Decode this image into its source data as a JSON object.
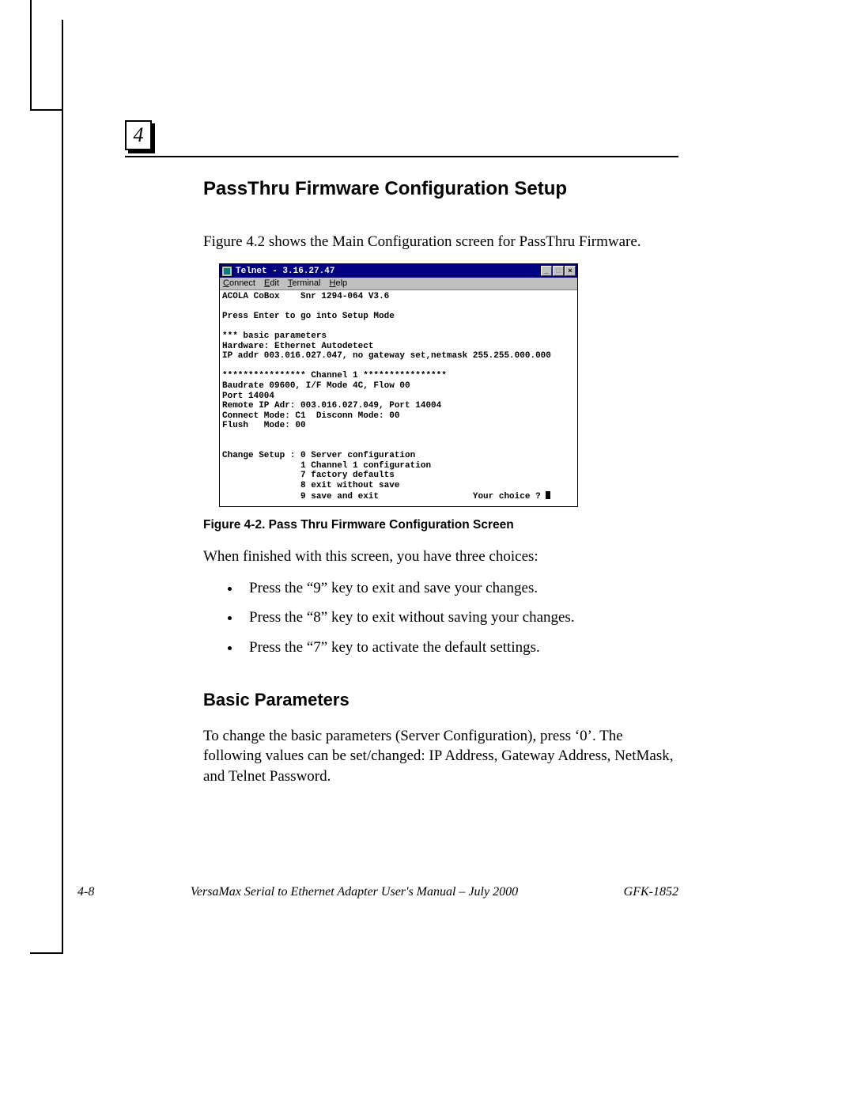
{
  "chapter_number": "4",
  "heading_main": "PassThru Firmware Configuration Setup",
  "intro_text": "Figure 4.2 shows the Main Configuration screen for PassThru Firmware.",
  "telnet": {
    "title": "Telnet - 3.16.27.47",
    "menu_connect": "Connect",
    "menu_edit": "Edit",
    "menu_terminal": "Terminal",
    "menu_help": "Help",
    "line01": "ACOLA CoBox    Snr 1294-064 V3.6",
    "line02": "Press Enter to go into Setup Mode",
    "line03": "*** basic parameters",
    "line04": "Hardware: Ethernet Autodetect",
    "line05": "IP addr 003.016.027.047, no gateway set,netmask 255.255.000.000",
    "line06": "**************** Channel 1 ****************",
    "line07": "Baudrate 09600, I/F Mode 4C, Flow 00",
    "line08": "Port 14004",
    "line09": "Remote IP Adr: 003.016.027.049, Port 14004",
    "line10": "Connect Mode: C1  Disconn Mode: 00",
    "line11": "Flush   Mode: 00",
    "line12": "Change Setup : 0 Server configuration",
    "line13": "               1 Channel 1 configuration",
    "line14": "               7 factory defaults",
    "line15": "               8 exit without save",
    "line16": "               9 save and exit                  Your choice ? "
  },
  "figure_caption": "Figure 4-2.  Pass Thru Firmware Configuration Screen",
  "after_figure_text": "When finished with this screen, you have three choices:",
  "choices": {
    "c1": "Press the “9” key to exit and save your changes.",
    "c2": "Press the “8” key to exit without saving your changes.",
    "c3": "Press the “7” key to activate the default settings."
  },
  "heading_basic": "Basic Parameters",
  "basic_text": "To change the basic parameters (Server Configuration), press ‘0’. The following values can be set/changed: IP Address, Gateway Address, NetMask, and Telnet Password.",
  "footer": {
    "page": "4-8",
    "title": "VersaMax Serial to Ethernet Adapter User's Manual – July 2000",
    "docnum": "GFK-1852"
  }
}
